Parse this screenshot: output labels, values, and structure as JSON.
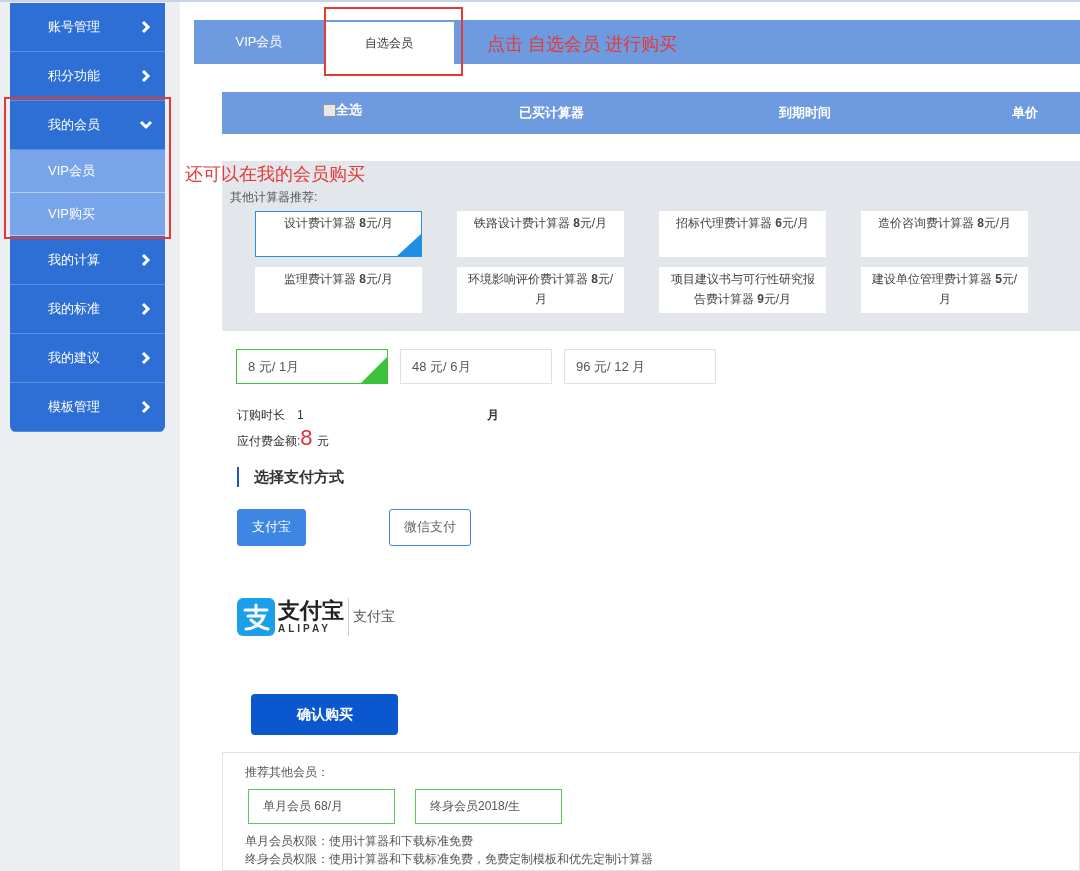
{
  "sidebar": {
    "items": [
      {
        "label": "账号管理",
        "expanded": false
      },
      {
        "label": "积分功能",
        "expanded": false
      },
      {
        "label": "我的会员",
        "expanded": true,
        "children": [
          {
            "label": "VIP会员"
          },
          {
            "label": "VIP购买"
          }
        ]
      },
      {
        "label": "我的计算",
        "expanded": false
      },
      {
        "label": "我的标准",
        "expanded": false
      },
      {
        "label": "我的建议",
        "expanded": false
      },
      {
        "label": "模板管理",
        "expanded": false
      }
    ]
  },
  "tabs": [
    {
      "label": "VIP会员",
      "selected": false
    },
    {
      "label": "自选会员",
      "selected": true
    }
  ],
  "table": {
    "select_all": {
      "label": "全选",
      "checked": false
    },
    "columns": [
      "已买计算器",
      "到期时间",
      "单价"
    ]
  },
  "recommend": {
    "label": "其他计算器推荐:",
    "cards": [
      {
        "text": "设计费计算器 **8**元/月",
        "selected": true
      },
      {
        "text": "铁路设计费计算器 **8**元/月",
        "selected": false
      },
      {
        "text": "招标代理费计算器 **6**元/月",
        "selected": false
      },
      {
        "text": "造价咨询费计算器 **8**元/月",
        "selected": false
      },
      {
        "text": "监理费计算器 **8**元/月",
        "selected": false
      },
      {
        "text": "环境影响评价费计算器 **8**元/月",
        "selected": false
      },
      {
        "text": "项目建议书与可行性研究报告费计算器 **9**元/月",
        "selected": false
      },
      {
        "text": "建设单位管理费计算器 **5**元/月",
        "selected": false
      }
    ]
  },
  "durations": [
    {
      "label": "8 元/ 1月",
      "selected": true
    },
    {
      "label": "48 元/ 6月",
      "selected": false
    },
    {
      "label": "96 元/ 12 月",
      "selected": false
    }
  ],
  "order": {
    "duration_label": "订购时长",
    "duration_value": "1",
    "duration_unit": "月",
    "amount_label": "应付费金额:",
    "amount": "8",
    "amount_unit": "元"
  },
  "payment": {
    "heading": "选择支付方式",
    "methods": [
      {
        "label": "支付宝",
        "selected": true
      },
      {
        "label": "微信支付",
        "selected": false
      }
    ],
    "logo": {
      "wordmark": "支付宝",
      "latin": "ALIPAY",
      "caption": "支付宝"
    }
  },
  "confirm_button": "确认购买",
  "other_members": {
    "label": "推荐其他会员：",
    "options": [
      "单月会员 68/月",
      "终身会员2018/生"
    ],
    "notes": [
      "单月会员权限：使用计算器和下载标准免费",
      "终身会员权限：使用计算器和下载标准免费，免费定制模板和优先定制计算器"
    ]
  },
  "annotations": [
    {
      "text": "点击 自选会员 进行购买"
    },
    {
      "text": "还可以在我的会员购买"
    }
  ]
}
